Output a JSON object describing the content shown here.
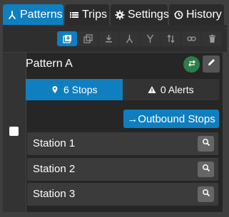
{
  "tabs": [
    {
      "label": "Patterns",
      "icon": "fork-icon",
      "active": true
    },
    {
      "label": "Trips",
      "icon": "list-icon",
      "active": false
    },
    {
      "label": "Settings",
      "icon": "gear-icon",
      "active": false
    },
    {
      "label": "History",
      "icon": "history-icon",
      "active": false
    }
  ],
  "toolbar": {
    "icons": [
      "add-pattern-icon",
      "duplicate-icon",
      "download-icon",
      "merge-icon",
      "split-icon",
      "reverse-icon",
      "link-icon",
      "trash-icon"
    ]
  },
  "pattern": {
    "title": "Pattern A",
    "stops_tab": "6 Stops",
    "alerts_tab": "0 Alerts",
    "outbound_label": "→Outbound Stops",
    "stations": [
      "Station 1",
      "Station 2",
      "Station 3"
    ]
  },
  "colors": {
    "accent": "#0f7fc0",
    "reverse_button": "#2e7d46"
  }
}
